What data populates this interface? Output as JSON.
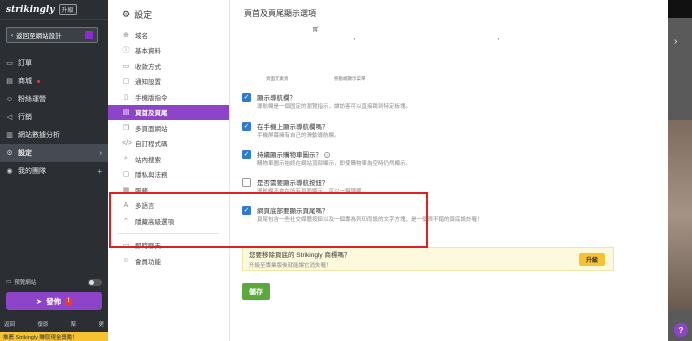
{
  "brand": {
    "name": "strikingly",
    "badge": "升級"
  },
  "back_button": "返回至網站設計",
  "left_nav": [
    {
      "label": "訂單",
      "icon": "cart-icon"
    },
    {
      "label": "商城",
      "icon": "store-icon",
      "dot": true
    },
    {
      "label": "粉絲運營",
      "icon": "people-icon"
    },
    {
      "label": "行銷",
      "icon": "megaphone-icon"
    },
    {
      "label": "網站數據分析",
      "icon": "chart-icon"
    },
    {
      "label": "設定",
      "icon": "gear-icon",
      "active": true
    },
    {
      "label": "我的團隊",
      "icon": "team-icon"
    }
  ],
  "preview_label": "預覽網站",
  "publish_label": "發佈",
  "publish_warning": "!",
  "bottom_links": [
    "返回",
    "復原",
    "幫",
    "更"
  ],
  "promo_text": "推薦 Strikingly 賺取現金獎勵！",
  "settings": {
    "title": "設定",
    "nav": [
      {
        "label": "域名",
        "icon": "globe-icon"
      },
      {
        "label": "基本資料",
        "icon": "info-icon"
      },
      {
        "label": "收款方式",
        "icon": "payment-icon"
      },
      {
        "label": "通知設置",
        "icon": "bell-icon"
      },
      {
        "label": "手機版指令",
        "icon": "mobile-icon"
      },
      {
        "label": "頁首及頁尾",
        "icon": "header-icon",
        "active": true
      },
      {
        "label": "多頁面網站",
        "icon": "pages-icon"
      },
      {
        "label": "自訂程式碼",
        "icon": "code-icon"
      },
      {
        "label": "站內搜索",
        "icon": "search-icon"
      },
      {
        "label": "隱私與法務",
        "icon": "privacy-icon"
      },
      {
        "label": "服務",
        "icon": "service-icon"
      },
      {
        "label": "多語言",
        "icon": "language-icon"
      },
      {
        "label": "隱藏高級選項",
        "icon": "chevron-up-icon"
      }
    ],
    "nav_extra": [
      {
        "label": "即時聊天",
        "icon": "chat-icon"
      },
      {
        "label": "會員功能",
        "icon": "member-icon"
      }
    ]
  },
  "content": {
    "title": "頁首及頁尾顯示選項",
    "preview_labels": [
      "頁面元素頁",
      "移動端顯示菜單"
    ],
    "options": [
      {
        "title": "顯示導航欄？",
        "desc": "導航欄是一個固定的瀏覽指示，讓訪客可以直接跳到特定板塊。",
        "checked": true,
        "help": false
      },
      {
        "title": "在手機上顯示導航欄嗎？",
        "desc": "手機屏幕擁有自己的滑動導航欄。",
        "checked": true,
        "help": false
      },
      {
        "title": "持續顯示購物車圖示？",
        "desc": "購物車圖示始終在網站頂部顯示，即使購物車為空時仍然顯示。",
        "checked": true,
        "help": true
      },
      {
        "title": "是否需要顯示導航按鈕？",
        "desc": "導航欄不會在所有頁面顯示，可以一鍵隱藏。",
        "checked": false,
        "help": false
      },
      {
        "title": "網頁底部要顯示頁尾嗎？",
        "desc": "頁尾包含一些社交媒體按鈕以及一個專為列印而設的文字方塊，是一個很不錯的頁底設計喔！",
        "checked": true,
        "help": false
      }
    ],
    "upgrade": {
      "title": "您要移除頁底的 Strikingly 商標嗎？",
      "desc": "升級至專業版後就能讓它消失喔！",
      "button": "升級"
    },
    "save_label": "儲存"
  },
  "help_button": "?"
}
